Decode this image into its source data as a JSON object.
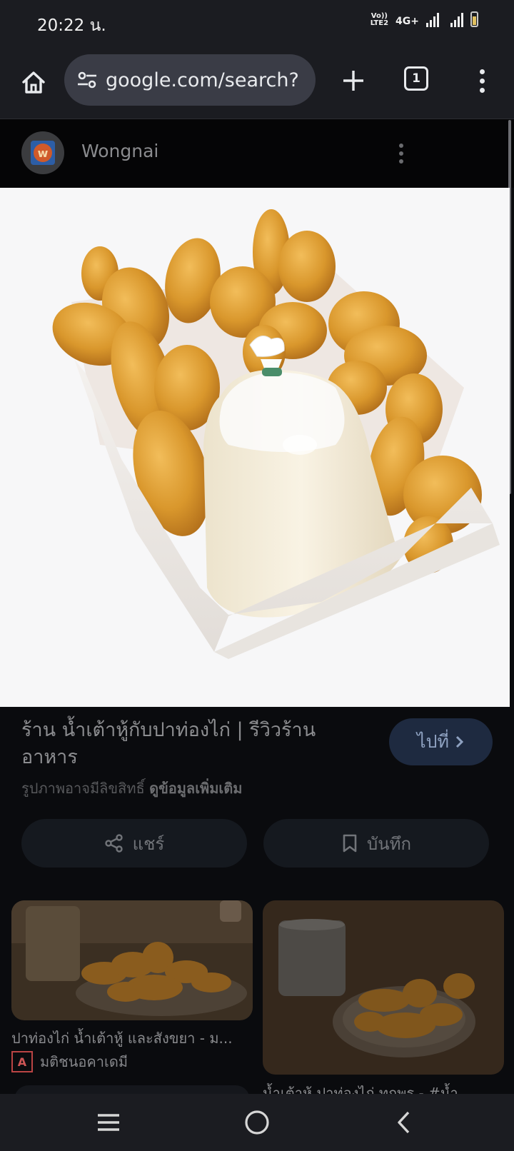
{
  "status_bar": {
    "time": "20:22 น.",
    "network": "4G+",
    "volte": "VoLTE2"
  },
  "browser": {
    "url": "google.com/search?",
    "tab_count": "1"
  },
  "source": {
    "name": "Wongnai"
  },
  "result": {
    "title": "ร้าน น้ำเต้าหู้กับปาท่องไก่ | รีวิวร้านอาหาร",
    "visit_label": "ไปที่",
    "copyright_notice": "รูปภาพอาจมีลิขสิทธิ์",
    "learn_more": "ดูข้อมูลเพิ่มเติม",
    "share_label": "แชร์",
    "save_label": "บันทึก"
  },
  "related": [
    {
      "caption": "ปาท่องไก่ น้ำเต้าหู้ และสังขยา - ม...",
      "source_name": "มติชนอคาเดมี",
      "source_logo": "A"
    },
    {
      "caption": "น้ำเต้าหู้ ปาท่องไก่ ทุกพร - #น้ำ..."
    }
  ],
  "colors": {
    "accent_button": "#1e2a40",
    "toolbar": "#1b1c21",
    "background": "#0a0b0e"
  },
  "icons": {
    "home": "home-icon",
    "site_settings": "tune-icon",
    "new_tab": "plus-icon",
    "menu": "more-vert-icon",
    "share": "share-icon",
    "save": "bookmark-icon",
    "nav_recents": "recents-icon",
    "nav_home": "circle-home-icon",
    "nav_back": "back-icon"
  }
}
